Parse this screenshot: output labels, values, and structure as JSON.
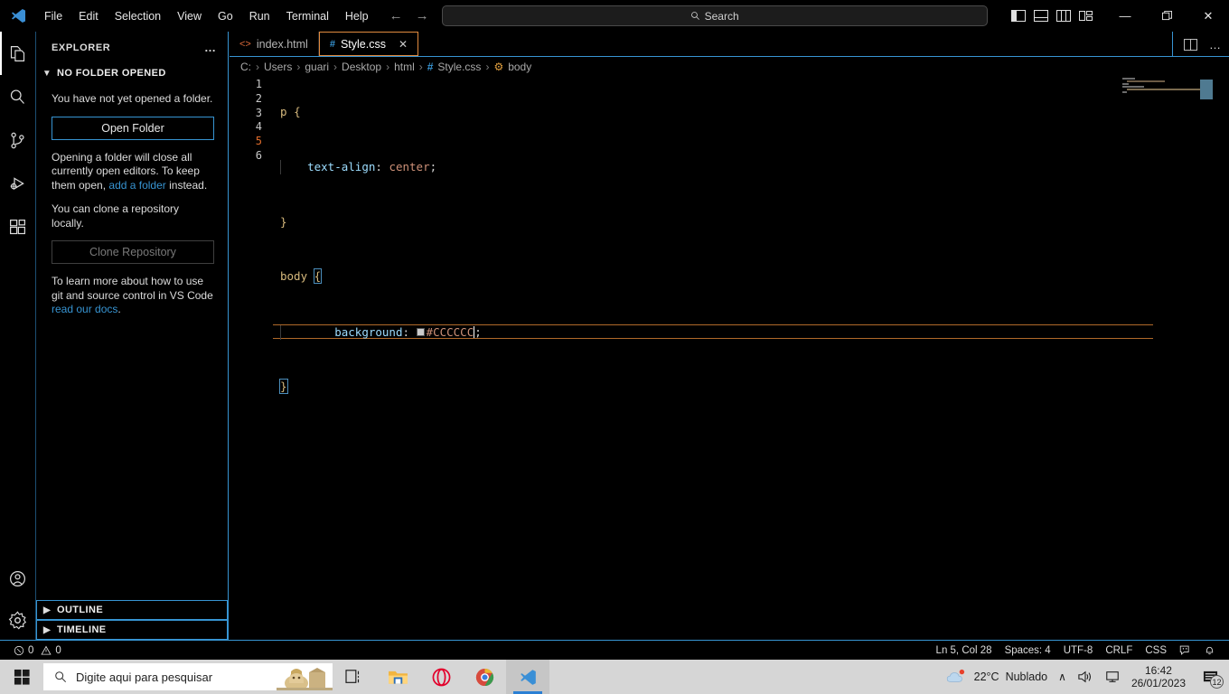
{
  "titlebar": {
    "logo_icon": "vscode-logo-icon",
    "menu": [
      {
        "label": "File"
      },
      {
        "label": "Edit"
      },
      {
        "label": "Selection"
      },
      {
        "label": "View"
      },
      {
        "label": "Go"
      },
      {
        "label": "Run"
      },
      {
        "label": "Terminal"
      },
      {
        "label": "Help"
      }
    ],
    "nav": {
      "back_icon": "arrow-left-icon",
      "forward_icon": "arrow-right-icon"
    },
    "search": {
      "placeholder": "Search",
      "value": "",
      "icon": "search-icon"
    },
    "layout_icons": [
      {
        "name": "toggle-primary-sidebar-icon"
      },
      {
        "name": "toggle-panel-icon"
      },
      {
        "name": "toggle-secondary-sidebar-icon"
      },
      {
        "name": "customize-layout-icon"
      }
    ],
    "window_controls": {
      "minimize": "—",
      "maximize": "❐",
      "close": "✕"
    }
  },
  "activitybar": {
    "items": [
      {
        "name": "explorer-icon",
        "label": "Explorer",
        "active": true
      },
      {
        "name": "search-icon",
        "label": "Search",
        "active": false
      },
      {
        "name": "source-control-icon",
        "label": "Source Control",
        "active": false
      },
      {
        "name": "run-debug-icon",
        "label": "Run and Debug",
        "active": false
      },
      {
        "name": "extensions-icon",
        "label": "Extensions",
        "active": false
      }
    ],
    "bottom_items": [
      {
        "name": "account-icon",
        "label": "Accounts"
      },
      {
        "name": "settings-gear-icon",
        "label": "Manage"
      }
    ]
  },
  "sidebar": {
    "title": "EXPLORER",
    "more_actions": "…",
    "section_title": "NO FOLDER OPENED",
    "no_folder_text": "You have not yet opened a folder.",
    "open_folder_button": "Open Folder",
    "open_folder_hint_1": "Opening a folder will close all currently open editors. To keep them open,",
    "open_folder_hint_link": "add a folder",
    "open_folder_hint_2": "instead.",
    "clone_text": "You can clone a repository locally.",
    "clone_button": "Clone Repository",
    "git_help_1": "To learn more about how to use git and source control in VS Code",
    "git_help_link": "read our docs",
    "git_help_2": ".",
    "outline_label": "OUTLINE",
    "timeline_label": "TIMELINE"
  },
  "editor": {
    "tabs": [
      {
        "label": "index.html",
        "icon": "html-file-icon",
        "active": false,
        "closable": false
      },
      {
        "label": "Style.css",
        "icon": "css-file-icon",
        "active": true,
        "closable": true,
        "close_glyph": "✕"
      }
    ],
    "tab_actions": [
      {
        "name": "split-editor-icon"
      },
      {
        "name": "more-actions-icon",
        "glyph": "…"
      }
    ],
    "breadcrumb": [
      {
        "label": "C:",
        "type": "path"
      },
      {
        "label": "Users",
        "type": "path"
      },
      {
        "label": "guari",
        "type": "path"
      },
      {
        "label": "Desktop",
        "type": "path"
      },
      {
        "label": "html",
        "type": "path"
      },
      {
        "label": "Style.css",
        "type": "file"
      },
      {
        "label": "body",
        "type": "symbol"
      }
    ],
    "breadcrumb_separator": "›",
    "line_numbers": [
      "1",
      "2",
      "3",
      "4",
      "5",
      "6"
    ],
    "active_line": 5,
    "code": {
      "line1_selector": "p",
      "line1_brace": "{",
      "line2_prop": "text-align",
      "line2_colon": ":",
      "line2_value": "center",
      "line2_semi": ";",
      "line3_brace": "}",
      "line4_selector": "body",
      "line4_brace": "{",
      "line5_prop": "background",
      "line5_colon": ":",
      "line5_value": "#CCCCCC",
      "line5_semi": ";",
      "line5_swatch_color": "#CCCCCC",
      "line6_brace": "}"
    }
  },
  "statusbar": {
    "errors_icon": "error-circle-icon",
    "errors": "0",
    "warnings_icon": "warning-triangle-icon",
    "warnings": "0",
    "cursor_position": "Ln 5, Col 28",
    "indentation": "Spaces: 4",
    "encoding": "UTF-8",
    "eol": "CRLF",
    "language": "CSS",
    "feedback_icon": "feedback-smiley-icon",
    "notifications_icon": "bell-icon"
  },
  "taskbar": {
    "start_icon": "windows-start-icon",
    "search_placeholder": "Digite aqui para pesquisar",
    "search_value": "",
    "search_icon": "search-icon",
    "apps": [
      {
        "name": "task-view-icon",
        "label": "Task View",
        "active": false
      },
      {
        "name": "file-explorer-icon",
        "label": "File Explorer",
        "active": false
      },
      {
        "name": "opera-icon",
        "label": "Opera",
        "active": false
      },
      {
        "name": "chrome-icon",
        "label": "Google Chrome",
        "active": false
      },
      {
        "name": "vscode-icon",
        "label": "Visual Studio Code",
        "active": true
      }
    ],
    "weather": {
      "icon": "cloud-icon",
      "temperature": "22°C",
      "condition": "Nublado"
    },
    "tray": {
      "chevron": "∧",
      "volume_icon": "speaker-icon",
      "network_icon": "network-monitor-icon"
    },
    "clock": {
      "time": "16:42",
      "date": "26/01/2023"
    },
    "notifications": {
      "icon": "notification-icon",
      "count": "12"
    }
  },
  "colors": {
    "accent_blue": "#3794d2",
    "tab_active_border": "#e28b3f",
    "active_line_border": "#b06a2a",
    "swatch": "#CCCCCC",
    "taskbar_bg": "#d6d6d6"
  }
}
